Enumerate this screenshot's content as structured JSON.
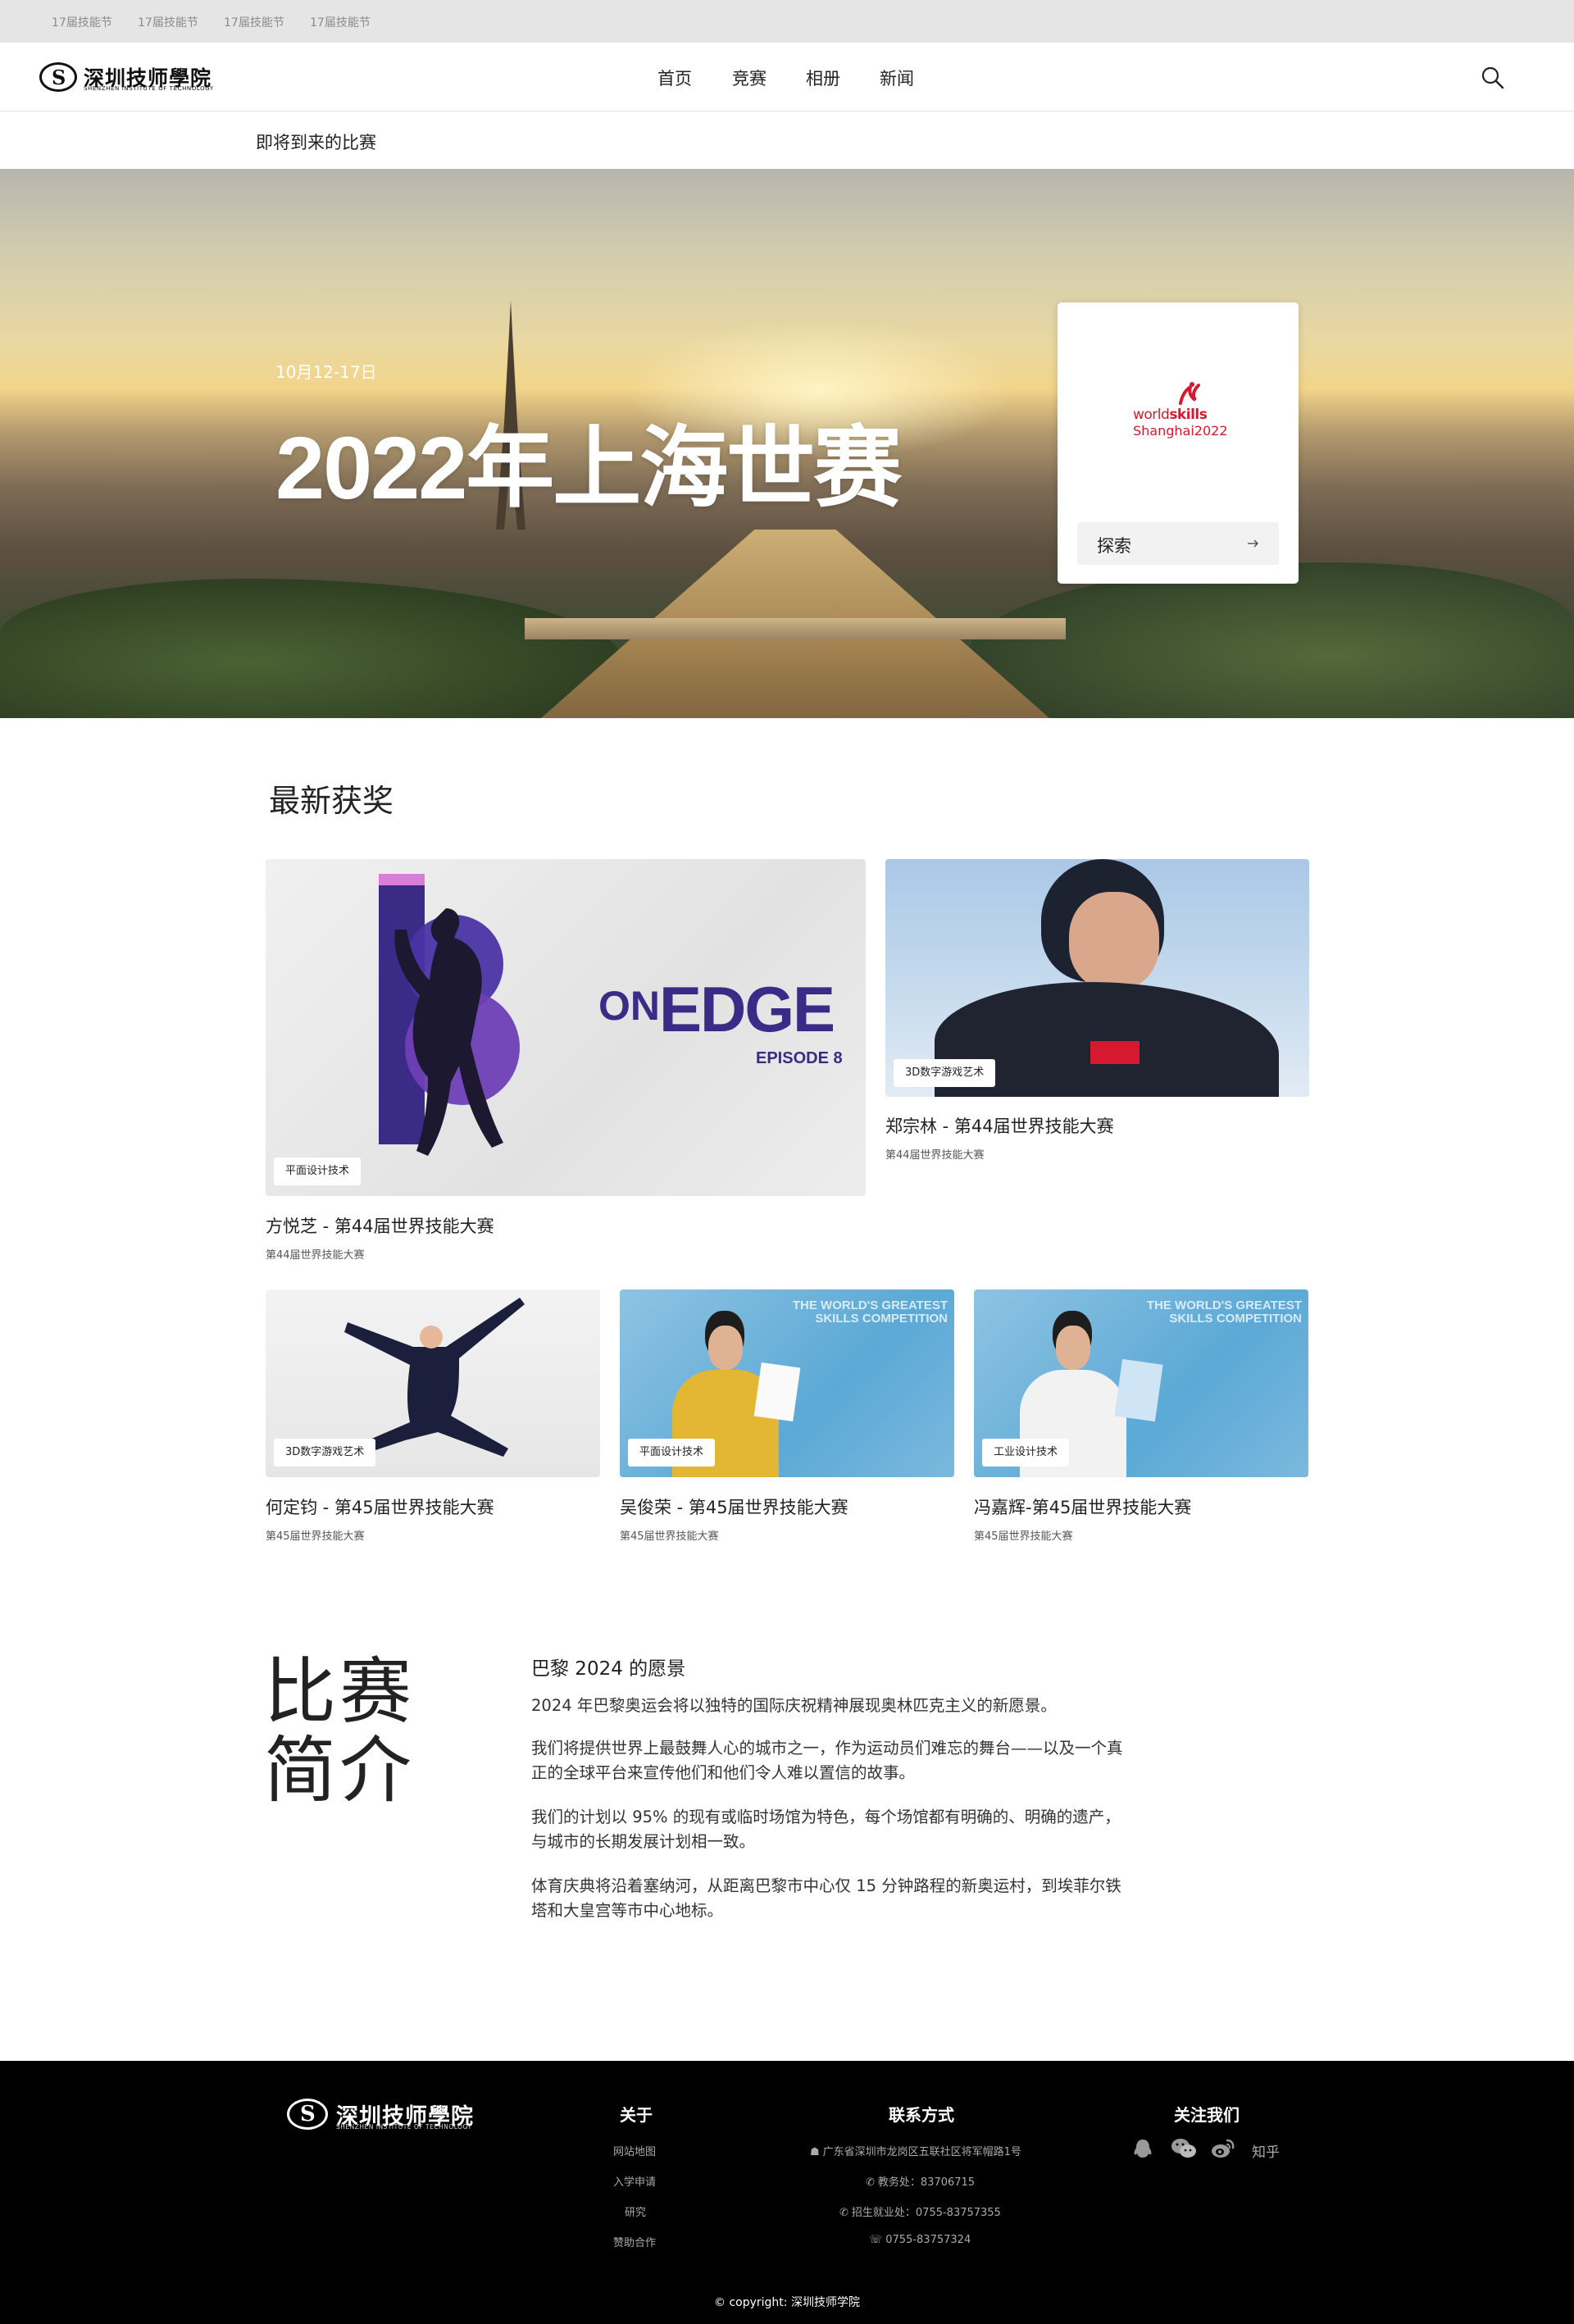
{
  "topbar": {
    "items": [
      "17届技能节",
      "17届技能节",
      "17届技能节",
      "17届技能节"
    ]
  },
  "header": {
    "logo": {
      "cn": "深圳技师學院",
      "en": "SHENZHEN INSTITUTE OF TECHNOLOGY"
    },
    "nav": [
      "首页",
      "竞赛",
      "相册",
      "新闻"
    ],
    "search_icon": "search-icon"
  },
  "subheader": {
    "label": "即将到来的比赛"
  },
  "hero": {
    "date": "10月12-17日",
    "title": "2022年上海世赛",
    "card": {
      "logo_word_a": "world",
      "logo_word_b": "skills",
      "logo_city": "Shanghai2022",
      "explore_label": "探索",
      "accent": "#d7192f"
    }
  },
  "awards": {
    "title": "最新获奖",
    "items": [
      {
        "tag": "平面设计技术",
        "title": "方悦芝 - 第44届世界技能大赛",
        "subtitle": "第44届世界技能大赛",
        "poster_word_a": "ON",
        "poster_word_b": "EDGE",
        "poster_word_c": "EPISODE 8"
      },
      {
        "tag": "3D数字游戏艺术",
        "title": "郑宗林 - 第44届世界技能大赛",
        "subtitle": "第44届世界技能大赛"
      },
      {
        "tag": "3D数字游戏艺术",
        "title": "何定钧 - 第45届世界技能大赛",
        "subtitle": "第45届世界技能大赛"
      },
      {
        "tag": "平面设计技术",
        "title": "吴俊荣 - 第45届世界技能大赛",
        "subtitle": "第45届世界技能大赛",
        "banner": "THE WORLD'S GREATEST SKILLS COMPETITION"
      },
      {
        "tag": "工业设计技术",
        "title": "冯嘉辉-第45届世界技能大赛",
        "subtitle": "第45届世界技能大赛",
        "banner": "THE WORLD'S GREATEST SKILLS COMPETITION"
      }
    ]
  },
  "intro": {
    "heading": "比赛简介",
    "question": "巴黎 2024 的愿景",
    "paragraphs": [
      "2024 年巴黎奥运会将以独特的国际庆祝精神展现奥林匹克主义的新愿景。",
      "我们将提供世界上最鼓舞人心的城市之一，作为运动员们难忘的舞台——以及一个真正的全球平台来宣传他们和他们令人难以置信的故事。",
      "我们的计划以 95% 的现有或临时场馆为特色，每个场馆都有明确的、明确的遗产，与城市的长期发展计划相一致。",
      "体育庆典将沿着塞纳河，从距离巴黎市中心仅 15 分钟路程的新奥运村，到埃菲尔铁塔和大皇宫等市中心地标。"
    ]
  },
  "footer": {
    "about": {
      "title": "关于",
      "links": [
        "网站地图",
        "入学申请",
        "研究",
        "赞助合作"
      ]
    },
    "contact": {
      "title": "联系方式",
      "address": "广东省深圳市龙岗区五联社区将军帽路1号",
      "phone1": "教务处：83706715",
      "phone2": "招生就业处：0755-83757355",
      "fax": "0755-83757324"
    },
    "follow": {
      "title": "关注我们",
      "icons": [
        "qq-icon",
        "wechat-icon",
        "weibo-icon"
      ],
      "zhihu": "知乎"
    },
    "copyright": "© copyright: 深圳技师学院"
  }
}
